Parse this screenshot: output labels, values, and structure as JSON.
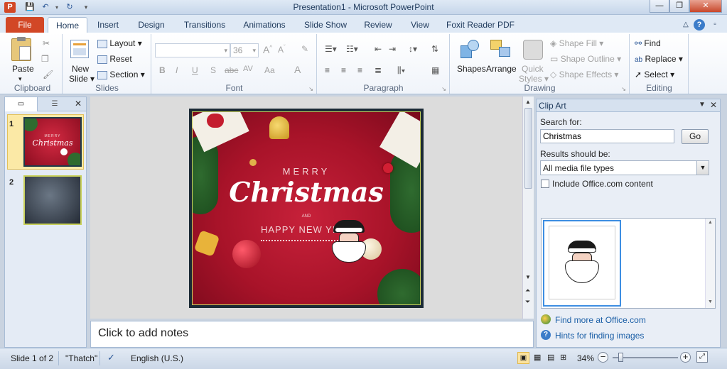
{
  "window": {
    "title": "Presentation1 - Microsoft PowerPoint",
    "minimize": "—",
    "restore": "❐",
    "close": "✕"
  },
  "tabs": [
    "File",
    "Insert",
    "Design",
    "Transitions",
    "Animations",
    "Slide Show",
    "Review",
    "View",
    "Foxit Reader PDF"
  ],
  "active_tab": "Home",
  "ribbon": {
    "clipboard": {
      "label": "Clipboard",
      "paste": "Paste"
    },
    "slides": {
      "label": "Slides",
      "new_slide_1": "New",
      "new_slide_2": "Slide ▾",
      "layout": "Layout ▾",
      "reset": "Reset",
      "section": "Section ▾"
    },
    "font": {
      "label": "Font",
      "font_size": "36",
      "bold": "B",
      "italic": "I",
      "underline": "U",
      "shadow": "S",
      "strike": "abc",
      "spacing": "AV",
      "case": "Aa",
      "color": "A"
    },
    "paragraph": {
      "label": "Paragraph"
    },
    "drawing": {
      "label": "Drawing",
      "shapes": "Shapes",
      "arrange": "Arrange",
      "quick_styles_1": "Quick",
      "quick_styles_2": "Styles ▾",
      "shape_fill": "Shape Fill ▾",
      "shape_outline": "Shape Outline ▾",
      "shape_effects": "Shape Effects ▾"
    },
    "editing": {
      "label": "Editing",
      "find": "Find",
      "replace": "Replace ▾",
      "select": "Select ▾"
    }
  },
  "thumbnails": [
    {
      "num": "1",
      "merry": "MERRY",
      "christmas": "Christmas"
    },
    {
      "num": "2"
    }
  ],
  "slide": {
    "merry": "MERRY",
    "christmas": "Christmas",
    "and": "AND",
    "happy": "HAPPY NEW YE"
  },
  "notes_placeholder": "Click to add notes",
  "clip_art": {
    "title": "Clip Art",
    "search_label": "Search for:",
    "search_value": "Christmas",
    "go": "Go",
    "results_label": "Results should be:",
    "results_value": "All media file types",
    "include_office": "Include Office.com content",
    "find_more": "Find more at Office.com",
    "hints": "Hints for finding images"
  },
  "status": {
    "slide": "Slide 1 of 2",
    "theme": "\"Thatch\"",
    "language": "English (U.S.)",
    "zoom": "34%",
    "zoom_level": 0.34
  },
  "colors": {
    "accent": "#d24726",
    "ribbon_blue": "#1e395b",
    "slide_red": "#b01530"
  }
}
